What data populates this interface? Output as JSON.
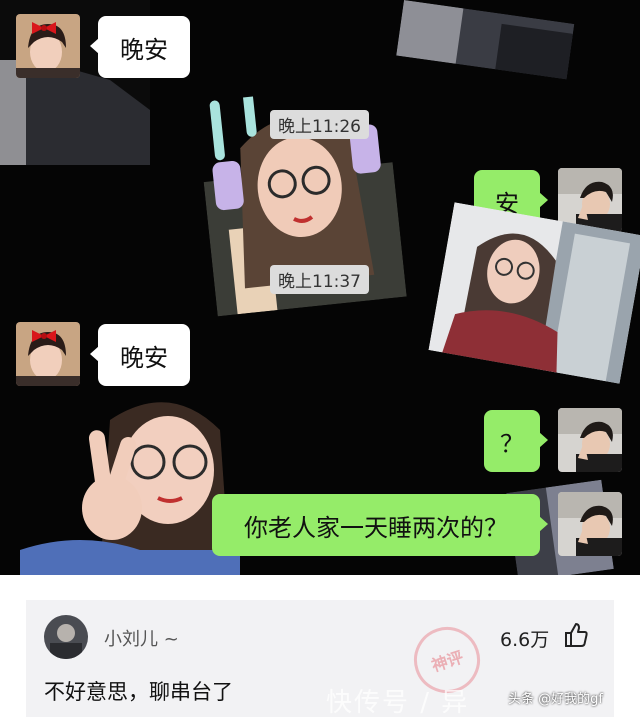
{
  "chat": {
    "messages": [
      {
        "side": "left",
        "text": "晚安"
      },
      {
        "type": "time",
        "text": "晚上11:26"
      },
      {
        "side": "right",
        "text": "安"
      },
      {
        "type": "time",
        "text": "晚上11:37"
      },
      {
        "side": "left",
        "text": "晚安"
      },
      {
        "side": "right",
        "text": "？"
      },
      {
        "side": "right",
        "text": "你老人家一天睡两次的？"
      }
    ]
  },
  "comment": {
    "username": "小刘儿 ~",
    "likes": "6.6万",
    "text": "不好意思，聊串台了",
    "stamp": "神评"
  },
  "watermark": {
    "main": "快传号 / 异",
    "account": "头条 @好我的gf"
  },
  "colors": {
    "chat_background": "#050505",
    "sent_bubble": "#95ec69",
    "received_bubble": "#ffffff",
    "comment_card": "#f2f2f4"
  },
  "icons": [
    "like-thumb-icon",
    "bow-icon",
    "peace-sign-icon"
  ]
}
